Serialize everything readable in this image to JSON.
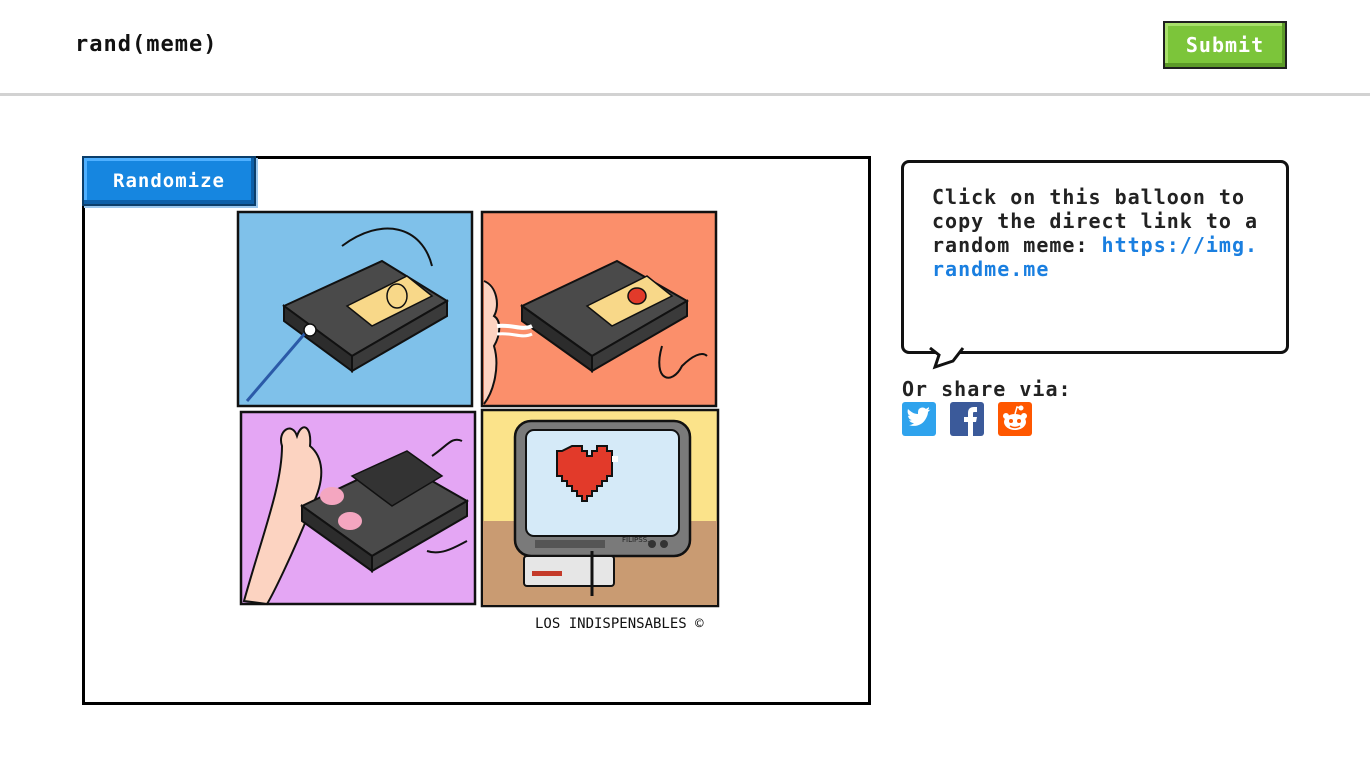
{
  "header": {
    "brand": "rand(meme)",
    "submit_label": "Submit"
  },
  "main": {
    "randomize_label": "Randomize",
    "meme": {
      "credit": "LOS INDISPENSABLES ©",
      "tv_brand": "FILIPSS."
    }
  },
  "sidebar": {
    "balloon_text": "Click on this balloon to copy the direct link to a random meme:",
    "balloon_link": "https://img.randme.me",
    "share_label": "Or share via:",
    "share": [
      {
        "name": "twitter-icon",
        "color": "#2fa3ed"
      },
      {
        "name": "facebook-icon",
        "color": "#3b5a9a"
      },
      {
        "name": "reddit-icon",
        "color": "#ff5700"
      }
    ]
  },
  "colors": {
    "submit": "#7cc53a",
    "randomize": "#1686e0",
    "link": "#1a7fe0"
  }
}
